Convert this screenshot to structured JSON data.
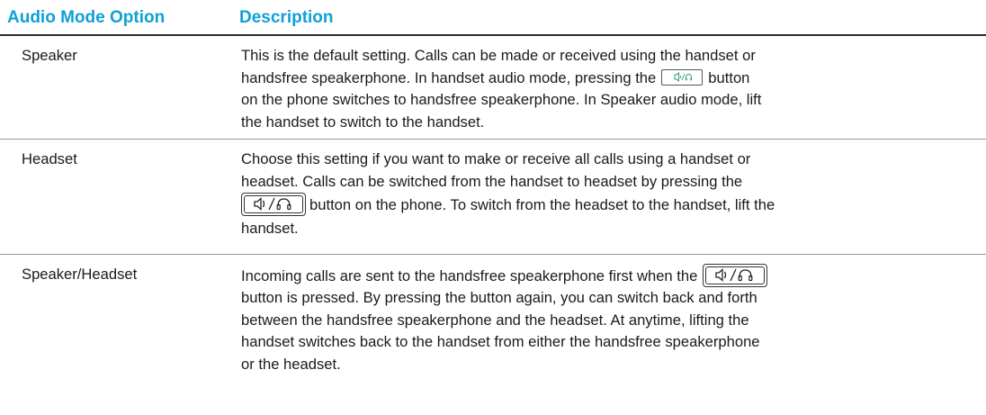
{
  "table": {
    "headers": {
      "option": "Audio Mode Option",
      "description": "Description"
    },
    "rows": [
      {
        "option": "Speaker",
        "lines": {
          "l1": "This is the default setting. Calls can be made or received using the handset or",
          "l2a": "handsfree speakerphone. In handset audio mode, pressing the",
          "l2b": "button",
          "l3": "on the phone switches to handsfree speakerphone. In Speaker audio mode, lift",
          "l4": "the handset to switch to the handset."
        },
        "button_icon": "speaker-headset-key-icon"
      },
      {
        "option": "Headset",
        "lines": {
          "l1": "Choose this setting if you want to make or receive all calls using a handset or",
          "l2": "headset. Calls can be switched from the handset to headset by pressing the",
          "l3b": "button on the phone. To switch from the headset to the handset, lift the",
          "l4": "handset."
        },
        "button_icon": "speaker-headset-key-icon"
      },
      {
        "option": "Speaker/Headset",
        "lines": {
          "l1a": "Incoming calls are sent to the handsfree speakerphone first when the",
          "l2": "button is pressed. By pressing the button again, you can switch back and forth",
          "l3": "between the handsfree speakerphone and the headset. At anytime, lifting the",
          "l4": "handset switches back to the handset from either the handsfree speakerphone",
          "l5": "or the headset."
        },
        "button_icon": "speaker-headset-key-icon"
      }
    ]
  },
  "colors": {
    "header_text": "#0ea0d6",
    "body_text": "#1a1a1a",
    "rule_thick": "#2b2b2b",
    "rule_thin": "#9a9a9a",
    "key_icon_green": "#2a9d6a"
  }
}
